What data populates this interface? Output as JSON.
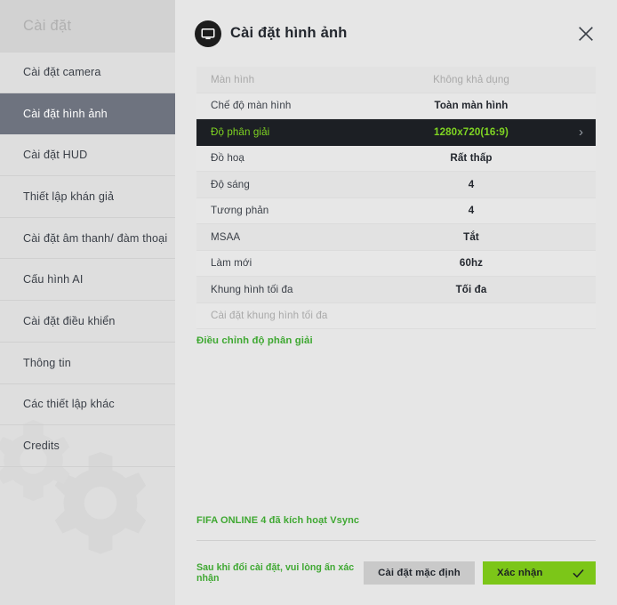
{
  "sidebar": {
    "header_title": "Cài đặt",
    "items": [
      {
        "label": "Cài đặt camera",
        "active": false
      },
      {
        "label": "Cài đặt hình ảnh",
        "active": true
      },
      {
        "label": "Cài đặt HUD",
        "active": false
      },
      {
        "label": "Thiết lập khán giả",
        "active": false
      },
      {
        "label": "Cài đặt âm thanh/ đàm thoại",
        "active": false
      },
      {
        "label": "Cấu hình AI",
        "active": false
      },
      {
        "label": "Cài đặt điều khiển",
        "active": false
      },
      {
        "label": "Thông tin",
        "active": false
      },
      {
        "label": "Các thiết lập khác",
        "active": false
      },
      {
        "label": "Credits",
        "active": false
      }
    ]
  },
  "main": {
    "title": "Cài đặt hình ảnh",
    "icon": "monitor-icon",
    "close_icon": "close-icon",
    "settings": [
      {
        "label": "Màn hình",
        "value": "Không khả dụng",
        "state": "disabled"
      },
      {
        "label": "Chế độ màn hình",
        "value": "Toàn màn hình",
        "state": "normal"
      },
      {
        "label": "Độ phân giải",
        "value": "1280x720(16:9)",
        "state": "highlight",
        "chevron": "chevron-right-icon"
      },
      {
        "label": "Đồ hoạ",
        "value": "Rất thấp",
        "state": "normal"
      },
      {
        "label": "Độ sáng",
        "value": "4",
        "state": "normal"
      },
      {
        "label": "Tương phản",
        "value": "4",
        "state": "normal"
      },
      {
        "label": "MSAA",
        "value": "Tắt",
        "state": "normal"
      },
      {
        "label": "Làm mới",
        "value": "60hz",
        "state": "normal"
      },
      {
        "label": "Khung hình tối đa",
        "value": "Tối đa",
        "state": "normal"
      },
      {
        "label": "Cài đặt khung hình tối đa",
        "value": "",
        "state": "disabled"
      }
    ],
    "adjust_resolution_link": "Điều chỉnh độ phân giải"
  },
  "footer": {
    "vsync_note": "FIFA ONLINE 4 đã kích hoạt Vsync",
    "hint": "Sau khi đổi cài đặt, vui lòng ấn xác nhận",
    "default_button": "Cài đặt mặc định",
    "confirm_button": "Xác nhận",
    "confirm_icon": "check-icon"
  },
  "colors": {
    "accent_green": "#7fd422",
    "link_green": "#3fa832",
    "button_green": "#7cc618",
    "highlight_row_bg": "#1c1f24",
    "sidebar_active_bg": "#6e737f"
  }
}
